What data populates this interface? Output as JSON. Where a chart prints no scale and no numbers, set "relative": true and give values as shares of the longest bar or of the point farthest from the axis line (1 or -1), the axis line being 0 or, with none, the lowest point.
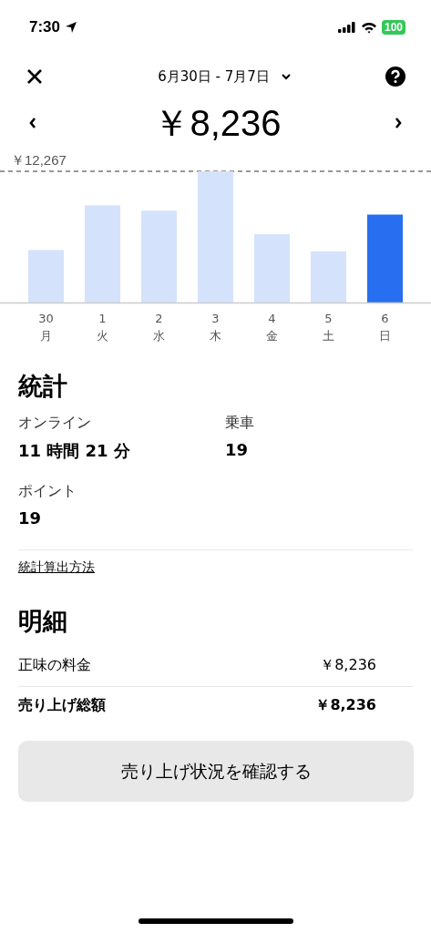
{
  "status_bar": {
    "time": "7:30",
    "battery": "100"
  },
  "header": {
    "date_range": "6月30日 - 7月7日"
  },
  "total": "￥8,236",
  "chart": {
    "chart_data": {
      "type": "bar",
      "categories": [
        "30",
        "1",
        "2",
        "3",
        "4",
        "5",
        "6"
      ],
      "values": [
        0.4,
        0.74,
        0.7,
        1,
        0.52,
        0.39,
        0.67
      ],
      "relative": true,
      "annotations": [
        {
          "text": "￥12,267"
        }
      ]
    },
    "bars": [
      {
        "weekday": "月",
        "selected": false
      },
      {
        "weekday": "火",
        "selected": false
      },
      {
        "weekday": "水",
        "selected": false
      },
      {
        "weekday": "木",
        "selected": false
      },
      {
        "weekday": "金",
        "selected": false
      },
      {
        "weekday": "土",
        "selected": false
      },
      {
        "weekday": "日",
        "selected": true
      }
    ]
  },
  "stats": {
    "title": "統計",
    "items": [
      {
        "label": "オンライン",
        "value": "11 時間 21 分"
      },
      {
        "label": "乗車",
        "value": "19"
      },
      {
        "label": "ポイント",
        "value": "19"
      }
    ],
    "link": "統計算出方法"
  },
  "details": {
    "title": "明細",
    "rows": [
      {
        "label": "正味の料金",
        "value": "￥8,236",
        "bold": false
      },
      {
        "label": "売り上げ総額",
        "value": "￥8,236",
        "bold": true
      }
    ]
  },
  "button": "売り上げ状況を確認する"
}
